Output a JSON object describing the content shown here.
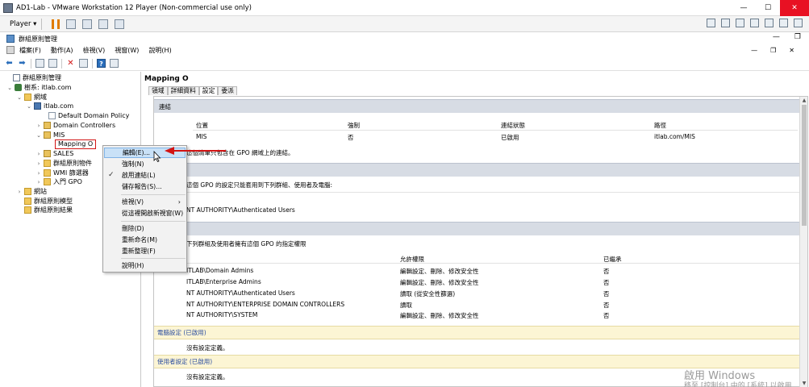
{
  "vm_window": {
    "title": "AD1-Lab - VMware Workstation 12 Player (Non-commercial use only)",
    "player_menu": "Player ▾",
    "controls": {
      "minimize": "—",
      "maximize": "☐",
      "close": "✕"
    }
  },
  "mmc": {
    "title": "群組原則管理",
    "controls": {
      "minimize": "—",
      "restore": "❐"
    },
    "menu": [
      "檔案(F)",
      "動作(A)",
      "檢視(V)",
      "視窗(W)",
      "說明(H)"
    ],
    "doc_controls": {
      "minimize": "—",
      "restore": "❐",
      "close": "✕"
    }
  },
  "tree": {
    "items": [
      {
        "label": "群組原則管理",
        "exp": ""
      },
      {
        "label": "樹系: itlab.com",
        "exp": "⌄"
      },
      {
        "label": "網域",
        "exp": "⌄"
      },
      {
        "label": "itlab.com",
        "exp": "⌄"
      },
      {
        "label": "Default Domain Policy",
        "exp": ""
      },
      {
        "label": "Domain Controllers",
        "exp": "›"
      },
      {
        "label": "MIS",
        "exp": "⌄"
      },
      {
        "label": "Mapping O",
        "exp": ""
      },
      {
        "label": "SALES",
        "exp": "›"
      },
      {
        "label": "群組原則物件",
        "exp": "›"
      },
      {
        "label": "WMI 篩選器",
        "exp": "›"
      },
      {
        "label": "入門 GPO",
        "exp": "›"
      },
      {
        "label": "網站",
        "exp": "›"
      },
      {
        "label": "群組原則模型",
        "exp": ""
      },
      {
        "label": "群組原則結果",
        "exp": ""
      }
    ]
  },
  "content": {
    "gpo_title": "Mapping O",
    "tabs": [
      "領域",
      "詳細資料",
      "設定",
      "委派"
    ],
    "active_tab": "設定",
    "links": {
      "header": "連結",
      "columns": [
        "位置",
        "強制",
        "連結狀態",
        "路徑"
      ],
      "row": [
        "MIS",
        "否",
        "已啟用",
        "itlab.com/MIS"
      ],
      "note": "這個清單只包含在 GPO 網域上的連結。"
    },
    "security_filter": {
      "note": "這個 GPO 的設定只能套用到下列群組、使用者及電腦:",
      "name_partial": "NT AUTHORITY\\Authenticated Users"
    },
    "delegation": {
      "note": "下列群組及使用者擁有這個 GPO 的指定權限",
      "columns": [
        "允許權限",
        "已繼承"
      ],
      "rows": [
        {
          "name": "ITLAB\\Domain Admins",
          "perm": "編輯設定、刪除、修改安全性",
          "inherited": "否"
        },
        {
          "name": "ITLAB\\Enterprise Admins",
          "perm": "編輯設定、刪除、修改安全性",
          "inherited": "否"
        },
        {
          "name": "NT AUTHORITY\\Authenticated Users",
          "perm": "讀取 (從安全性篩選)",
          "inherited": "否"
        },
        {
          "name": "NT AUTHORITY\\ENTERPRISE DOMAIN CONTROLLERS",
          "perm": "讀取",
          "inherited": "否"
        },
        {
          "name": "NT AUTHORITY\\SYSTEM",
          "perm": "編輯設定、刪除、修改安全性",
          "inherited": "否"
        }
      ]
    },
    "computer_config": {
      "header": "電腦設定 (已啟用)",
      "note": "沒有設定定義。"
    },
    "user_config": {
      "header": "使用者設定 (已啟用)",
      "note": "沒有設定定義。"
    }
  },
  "context_menu": {
    "items": [
      {
        "label": "編輯(E)...",
        "highlighted": true
      },
      {
        "label": "強制(N)"
      },
      {
        "label": "啟用連結(L)",
        "checked": true
      },
      {
        "label": "儲存報告(S)..."
      },
      {
        "label": "檢視(V)",
        "submenu": true
      },
      {
        "label": "從這裡開啟新視窗(W)"
      },
      {
        "label": "刪除(D)"
      },
      {
        "label": "重新命名(M)"
      },
      {
        "label": "重新整理(F)"
      },
      {
        "label": "說明(H)"
      }
    ],
    "check_glyph": "✓",
    "submenu_glyph": "›"
  },
  "watermark": {
    "line1": "啟用 Windows",
    "line2": "移至 [控制台] 中的 [系統] 以啟用 Windows。"
  },
  "colors": {
    "selection_border": "#d21414",
    "menu_highlight": "#c9e1f7",
    "section_header": "#d7dce4",
    "config_header": "#fcf5d4"
  }
}
